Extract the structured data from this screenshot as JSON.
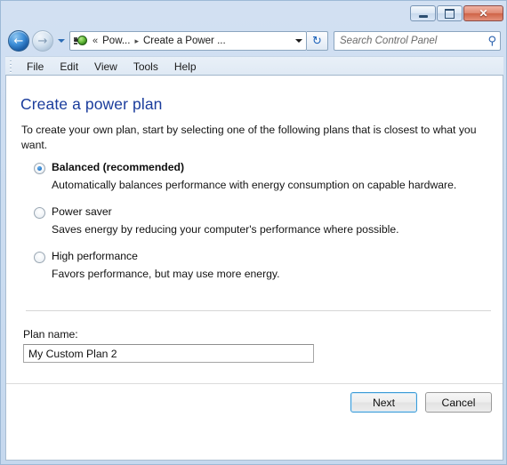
{
  "window": {
    "title": "",
    "buttons": {
      "minimize": "minimize",
      "maximize": "maximize",
      "close": "✕"
    }
  },
  "nav": {
    "back_glyph": "←",
    "forward_glyph": "→",
    "recent_pages_glyph": "",
    "address_icon": "power-options-icon",
    "chevrons": "«",
    "breadcrumbs": [
      {
        "label": "Pow...",
        "separator": "▸"
      },
      {
        "label": "Create a Power ...",
        "separator": ""
      }
    ],
    "dropdown_glyph": "",
    "refresh_glyph": "↻",
    "refresh_label": "Refresh"
  },
  "search": {
    "placeholder": "Search Control Panel",
    "value": "",
    "icon": "🔍",
    "icon_glyph": "⚲"
  },
  "menubar": {
    "items": [
      {
        "label": "File"
      },
      {
        "label": "Edit"
      },
      {
        "label": "View"
      },
      {
        "label": "Tools"
      },
      {
        "label": "Help"
      }
    ]
  },
  "main": {
    "page_title": "Create a power plan",
    "intro": "To create your own plan, start by selecting one of the following plans that is closest to what you want.",
    "plans": [
      {
        "label": "Balanced (recommended)",
        "description": "Automatically balances performance with energy consumption on capable hardware.",
        "selected": true
      },
      {
        "label": "Power saver",
        "description": "Saves energy by reducing your computer's performance where possible.",
        "selected": false
      },
      {
        "label": "High performance",
        "description": "Favors performance, but may use more energy.",
        "selected": false
      }
    ],
    "plan_name": {
      "label": "Plan name:",
      "value": "My Custom Plan 2",
      "placeholder": ""
    },
    "actions": {
      "next_label": "Next",
      "cancel_label": "Cancel"
    }
  },
  "colors": {
    "frame": "#c5d8ee",
    "title_accent": "#1a3c9c",
    "default_button_border": "#3c9bd6",
    "close_button": "#cf6347",
    "radio_dot": "#2b7fd0"
  }
}
